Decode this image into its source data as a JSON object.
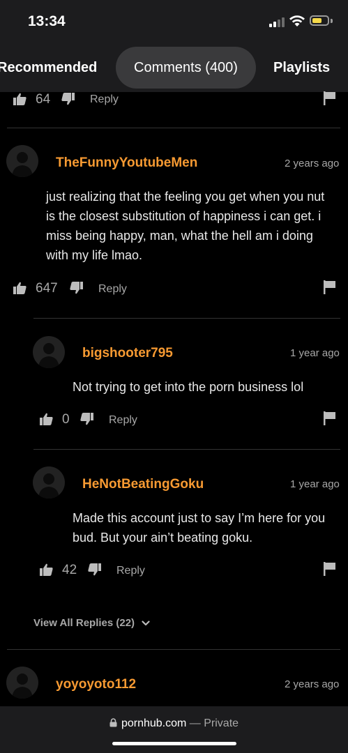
{
  "status_bar": {
    "time": "13:34",
    "battery_color": "#f5d94a"
  },
  "tabs": {
    "recommended": "Recommended",
    "comments": "Comments (400)",
    "playlists": "Playlists"
  },
  "top_comment": {
    "likes": "64",
    "reply": "Reply"
  },
  "comments": [
    {
      "username": "TheFunnyYoutubeMen",
      "time": "2 years ago",
      "text": "just realizing that the feeling you get when you nut is the closest substitution of happiness i can get. i miss being happy, man, what the hell am i doing with my life lmao.",
      "likes": "647",
      "reply": "Reply"
    },
    {
      "username": "bigshooter795",
      "time": "1 year ago",
      "text": "Not trying to get into the porn business lol",
      "likes": "0",
      "reply": "Reply"
    },
    {
      "username": "HeNotBeatingGoku",
      "time": "1 year ago",
      "text": "Made this account just to say I’m here for you bud. But your ain’t beating goku.",
      "likes": "42",
      "reply": "Reply"
    },
    {
      "username": "yoyoyoto112",
      "time": "2 years ago"
    }
  ],
  "view_all_replies": "View All Replies (22)",
  "url_bar": {
    "domain": "pornhub.com",
    "separator": " — ",
    "mode": "Private"
  },
  "colors": {
    "accent": "#f79a32",
    "background": "#000000",
    "bar": "#1c1c1e"
  },
  "icons": [
    "thumbs-up-icon",
    "thumbs-down-icon",
    "flag-icon",
    "chevron-down-icon",
    "lock-icon",
    "wifi-icon",
    "battery-icon",
    "signal-icon"
  ]
}
